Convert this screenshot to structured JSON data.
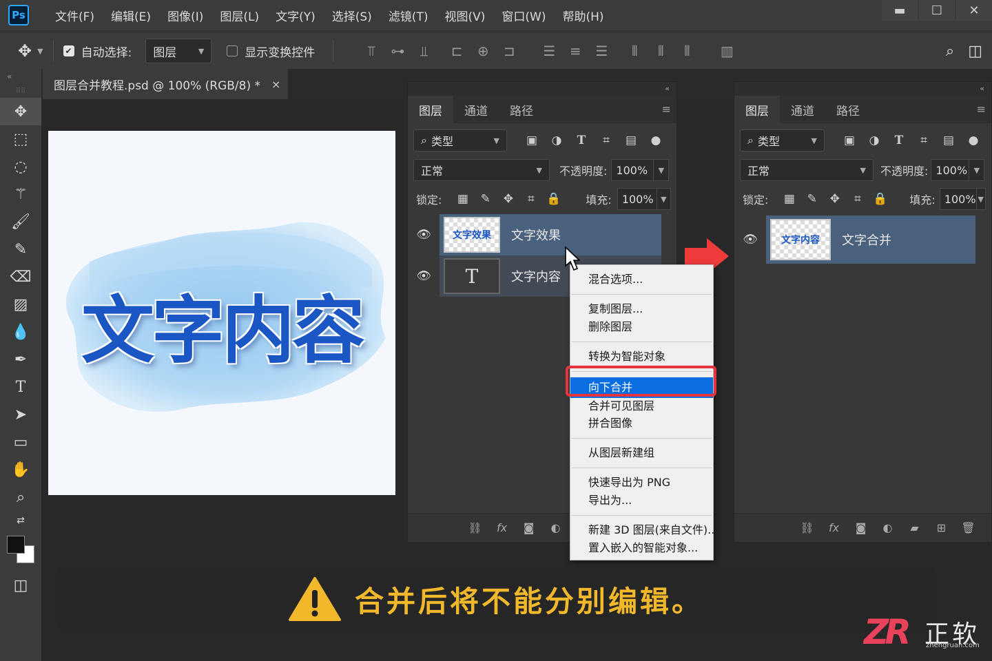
{
  "app": {
    "logo": "Ps"
  },
  "menu": [
    "文件(F)",
    "编辑(E)",
    "图像(I)",
    "图层(L)",
    "文字(Y)",
    "选择(S)",
    "滤镜(T)",
    "视图(V)",
    "窗口(W)",
    "帮助(H)"
  ],
  "window_controls": {
    "minimize": "▬",
    "maximize": "☐",
    "close": "✕"
  },
  "options": {
    "auto_select_label": "自动选择:",
    "auto_select_checked": true,
    "auto_select_value": "图层",
    "show_transform_label": "显示变换控件",
    "show_transform_checked": false
  },
  "document": {
    "tab_title": "图层合并教程.psd @ 100% (RGB/8) *",
    "close": "×",
    "canvas_text": "文字内容"
  },
  "left_panel": {
    "tabs": [
      "图层",
      "通道",
      "路径"
    ],
    "filter_kind": "类型",
    "blend_mode": "正常",
    "opacity_label": "不透明度:",
    "opacity_value": "100%",
    "lock_label": "锁定:",
    "fill_label": "填充:",
    "fill_value": "100%",
    "layers": [
      {
        "name": "文字效果",
        "thumb": "文字效果",
        "selected": true
      },
      {
        "name": "文字内容",
        "thumb": "T",
        "selected": false
      }
    ]
  },
  "right_panel": {
    "tabs": [
      "图层",
      "通道",
      "路径"
    ],
    "filter_kind": "类型",
    "blend_mode": "正常",
    "opacity_label": "不透明度:",
    "opacity_value": "100%",
    "lock_label": "锁定:",
    "fill_label": "填充:",
    "fill_value": "100%",
    "layers": [
      {
        "name": "文字合并",
        "thumb": "文字内容",
        "selected": true
      }
    ]
  },
  "context_menu": {
    "items": [
      "混合选项...",
      "复制图层...",
      "删除图层",
      "转换为智能对象",
      "向下合并",
      "合并可见图层",
      "拼合图像",
      "从图层新建组",
      "快速导出为 PNG",
      "导出为...",
      "新建 3D 图层(来自文件)...",
      "置入嵌入的智能对象..."
    ],
    "highlighted": "向下合并"
  },
  "banner": {
    "text": "合并后将不能分别编辑。"
  },
  "watermark": {
    "logo": "ZR",
    "name": "正软",
    "url": "zhengruan.com"
  },
  "colors": {
    "accent": "#31a8ff",
    "selection": "#0b6ee0",
    "highlight_box": "#e4343d",
    "banner_text": "#f1b82c",
    "canvas_text": "#1a56c4"
  }
}
